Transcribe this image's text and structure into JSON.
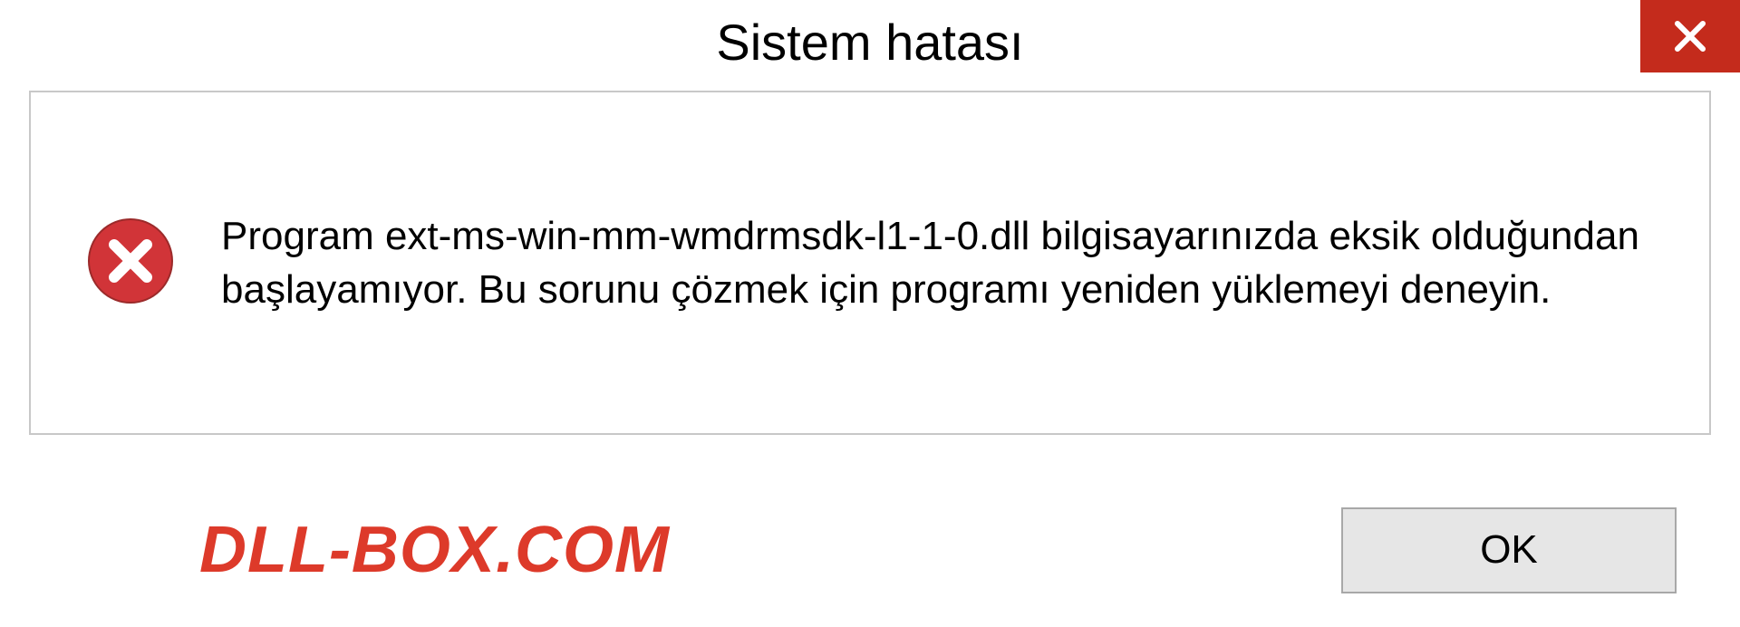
{
  "titlebar": {
    "title": "Sistem hatası"
  },
  "dialog": {
    "message": "Program ext-ms-win-mm-wmdrmsdk-l1-1-0.dll bilgisayarınızda eksik olduğundan başlayamıyor. Bu sorunu çözmek için programı yeniden yüklemeyi deneyin."
  },
  "footer": {
    "watermark": "DLL-BOX.COM",
    "ok_label": "OK"
  },
  "icons": {
    "close": "close-icon",
    "error": "error-icon"
  },
  "colors": {
    "close_bg": "#c42b1c",
    "error_red": "#d13438",
    "watermark_red": "#dd3a2a",
    "border_gray": "#c8c8c8",
    "btn_bg": "#e6e6e6"
  }
}
